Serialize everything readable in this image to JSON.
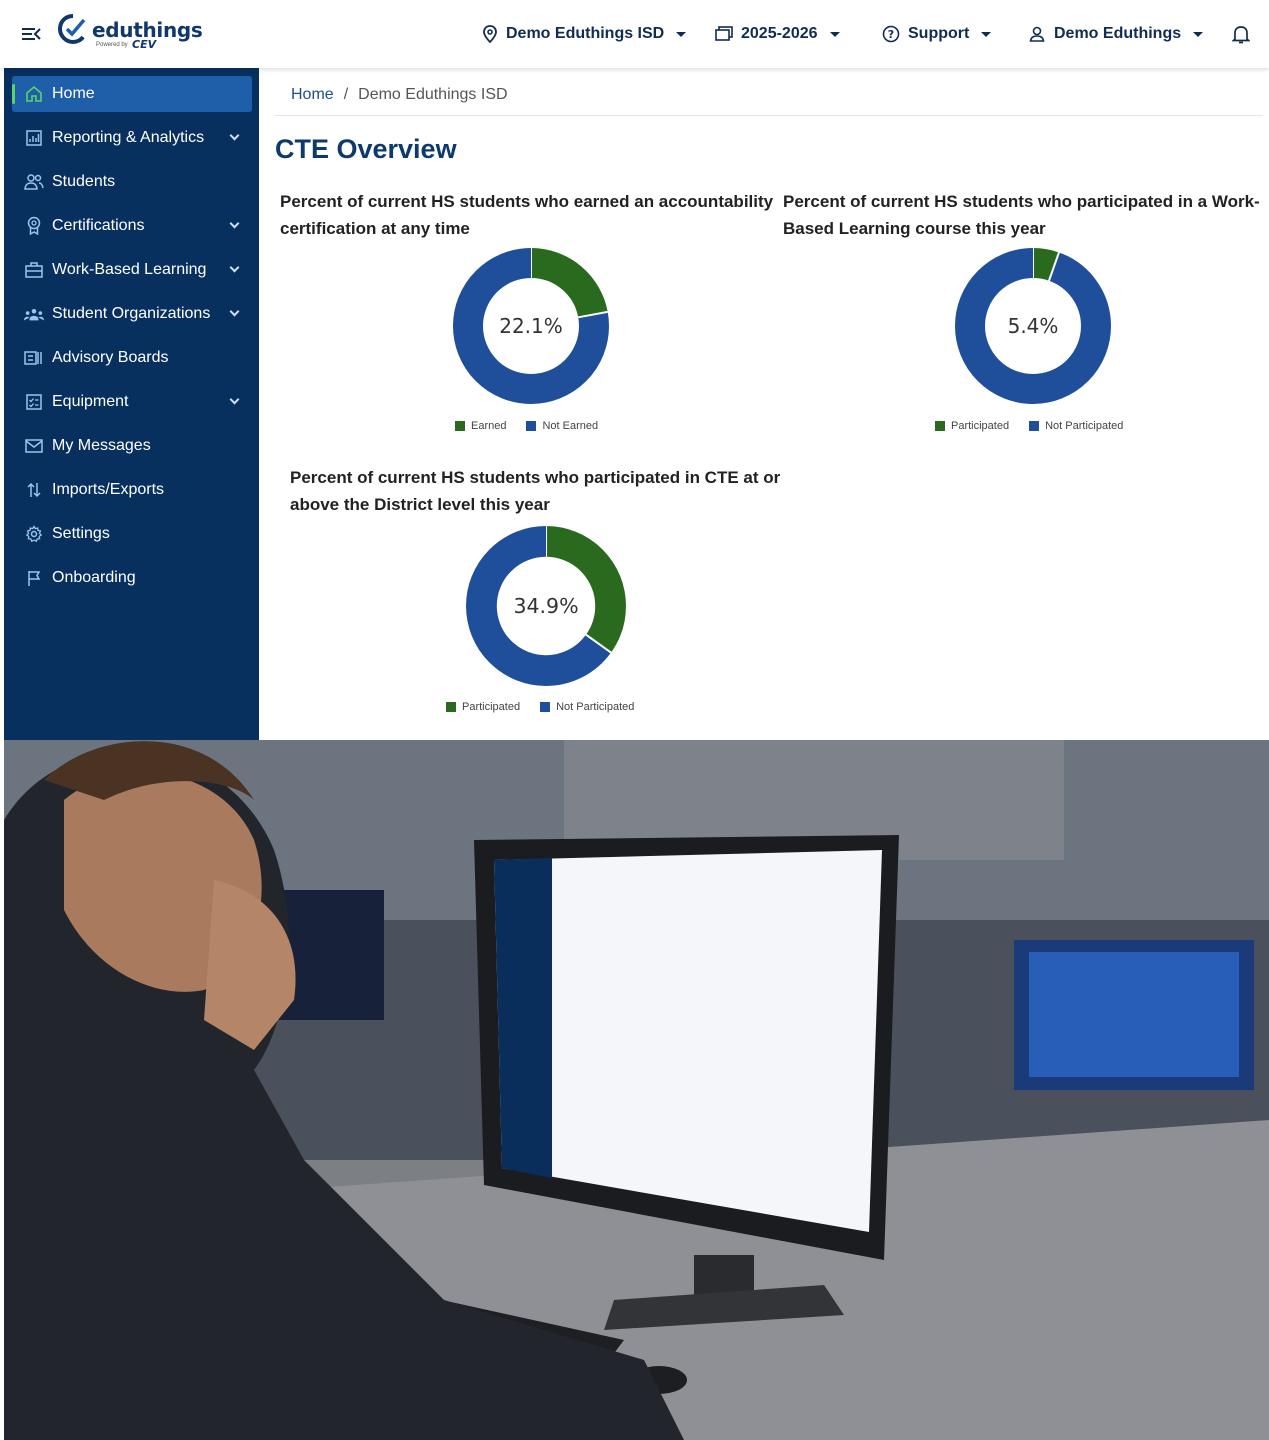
{
  "header": {
    "logo_text": "eduthings",
    "logo_powered": "Powered by",
    "logo_brand": "CEV",
    "district": "Demo Eduthings ISD",
    "year": "2025-2026",
    "support": "Support",
    "user": "Demo Eduthings"
  },
  "sidebar": {
    "items": [
      {
        "label": "Home",
        "icon": "home-icon",
        "active": true
      },
      {
        "label": "Reporting & Analytics",
        "icon": "chart-icon",
        "expandable": true
      },
      {
        "label": "Students",
        "icon": "users-icon"
      },
      {
        "label": "Certifications",
        "icon": "badge-icon",
        "expandable": true
      },
      {
        "label": "Work-Based Learning",
        "icon": "briefcase-icon",
        "expandable": true
      },
      {
        "label": "Student Organizations",
        "icon": "group-icon",
        "expandable": true
      },
      {
        "label": "Advisory Boards",
        "icon": "board-icon"
      },
      {
        "label": "Equipment",
        "icon": "checklist-icon",
        "expandable": true
      },
      {
        "label": "My Messages",
        "icon": "mail-icon"
      },
      {
        "label": "Imports/Exports",
        "icon": "import-export-icon"
      },
      {
        "label": "Settings",
        "icon": "gear-icon"
      },
      {
        "label": "Onboarding",
        "icon": "flag-icon"
      }
    ]
  },
  "breadcrumb": {
    "home": "Home",
    "sep": "/",
    "current": "Demo Eduthings ISD"
  },
  "page": {
    "title": "CTE Overview"
  },
  "colors": {
    "green": "#2a6a1e",
    "blue": "#1f4e9a",
    "sidebar": "#08305e",
    "accent": "#1f5ea8"
  },
  "chart_data": [
    {
      "type": "pie",
      "title": "Percent of current HS students who earned an accountability certification at any time",
      "center_label": "22.1%",
      "categories": [
        "Earned",
        "Not Earned"
      ],
      "values": [
        22.1,
        77.9
      ]
    },
    {
      "type": "pie",
      "title": "Percent of current HS students who participated in a Work-Based Learning course this year",
      "center_label": "5.4%",
      "categories": [
        "Participated",
        "Not Participated"
      ],
      "values": [
        5.4,
        94.6
      ]
    },
    {
      "type": "pie",
      "title": "Percent of current HS students who participated in CTE at or above the District level this year",
      "center_label": "34.9%",
      "categories": [
        "Participated",
        "Not Participated"
      ],
      "values": [
        34.9,
        65.1
      ]
    }
  ]
}
